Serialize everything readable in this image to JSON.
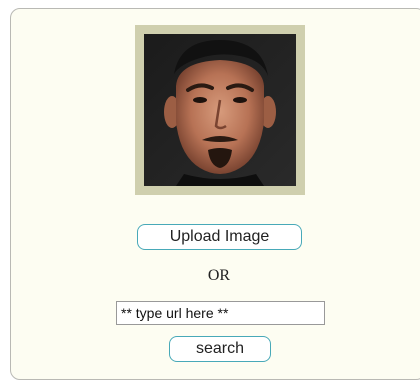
{
  "upload": {
    "label": "Upload Image"
  },
  "separator": {
    "text": "OR"
  },
  "url_input": {
    "value": "** type url here **"
  },
  "search": {
    "label": "search"
  },
  "colors": {
    "panel_bg": "#fdfdf2",
    "frame": "#cfcfae",
    "button_border": "#48a9b8"
  }
}
